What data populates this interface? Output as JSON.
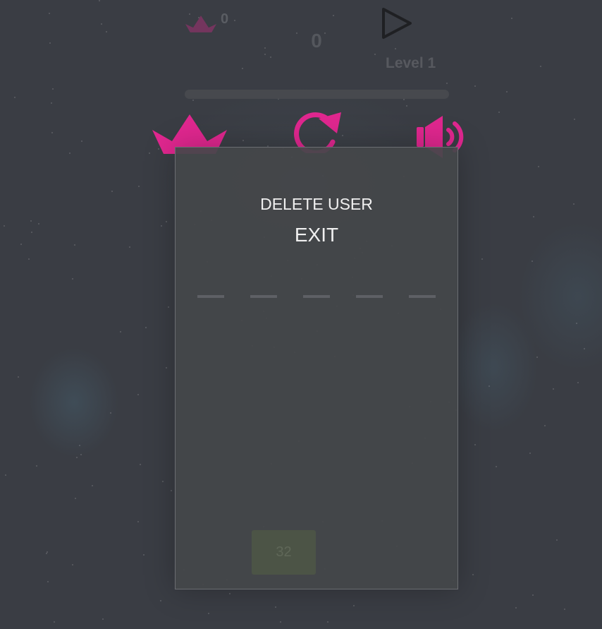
{
  "hud": {
    "best_score": "0",
    "score": "0",
    "level": "Level 1",
    "level_progress": 0
  },
  "icons": {
    "crown": "crown-icon",
    "play": "play-icon",
    "restart": "restart-icon",
    "sound": "sound-icon"
  },
  "modal": {
    "delete_user_label": "DELETE USER",
    "exit_label": "EXIT"
  },
  "slots": [
    "",
    "",
    "",
    "",
    ""
  ],
  "tile": {
    "value": "32"
  },
  "colors": {
    "accent": "#e0278f",
    "background": "#3a3d44",
    "panel": "#44464a",
    "tile": "#4c5446"
  }
}
